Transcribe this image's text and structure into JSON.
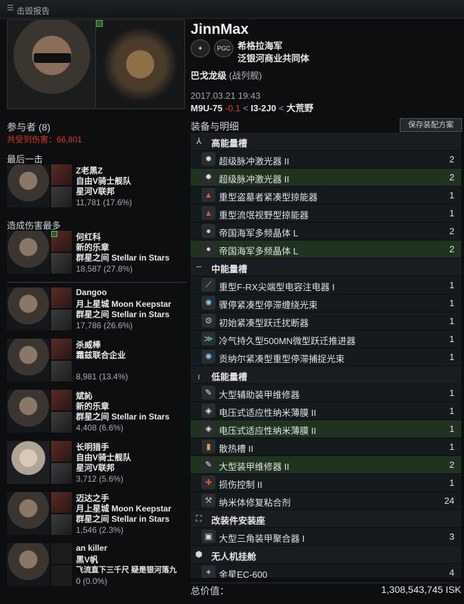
{
  "window": {
    "title": "击毁报告",
    "menu_icon": "menu-icon"
  },
  "victim": {
    "name": "JinnMax",
    "corporation": "希格拉海军",
    "alliance": "泛银河商业共同体",
    "alliance_logo_text": "PGC",
    "ship": "巴戈龙级",
    "ship_class": "(战列舰)",
    "datetime": "2017.03.21 19:43",
    "system": "M9U-75",
    "security": "-0.1",
    "sep1": "<",
    "region_part": "I3-2J0",
    "sep2": "<",
    "region": "大荒野"
  },
  "participants": {
    "header": "参与者 (8)",
    "damage_taken": "共受到伤害：66,801",
    "final_blow_header": "最后一击",
    "top_damage_header": "造成伤害最多",
    "final_blow": {
      "name": "Z老黑Z",
      "corp": "自由V骑士舰队",
      "alliance": "星河V联邦",
      "damage": "11,781 (17.6%)"
    },
    "attackers": [
      {
        "name": "何红科",
        "corp": "新的乐章",
        "alliance": "群星之间 Stellar in Stars",
        "damage": "18,587 (27.8%)"
      },
      {
        "name": "Dangoo",
        "corp": "月上星城 Moon Keepstar",
        "alliance": "群星之间 Stellar in Stars",
        "damage": "17,786 (26.6%)"
      },
      {
        "name": "杀威棒",
        "corp": "霜兹联合企业",
        "alliance": "",
        "damage": "8,981 (13.4%)"
      },
      {
        "name": "斌訫",
        "corp": "新的乐章",
        "alliance": "群星之间 Stellar in Stars",
        "damage": "4,408 (6.6%)"
      },
      {
        "name": "长明猎手",
        "corp": "自由V骑士舰队",
        "alliance": "星河V联邦",
        "damage": "3,712 (5.6%)"
      },
      {
        "name": "迈达之手",
        "corp": "月上星城 Moon Keepstar",
        "alliance": "群星之间 Stellar in Stars",
        "damage": "1,546 (2.3%)"
      },
      {
        "name": "an killer",
        "corp": "黑V帆",
        "alliance": "飞流直下三千尺 疑是银河落九",
        "damage": "0 (0.0%)"
      }
    ]
  },
  "fitting": {
    "header": "装备与明细",
    "save_button": "保存装配方案",
    "sections": [
      {
        "name": "高能量槽",
        "icon": "high-slot-icon",
        "items": [
          {
            "name": "超级脉冲激光器 II",
            "qty": "2",
            "dropped": false
          },
          {
            "name": "超级脉冲激光器 II",
            "qty": "2",
            "dropped": true
          },
          {
            "name": "重型盗墓者紧凑型掠能器",
            "qty": "1",
            "dropped": false
          },
          {
            "name": "重型流氓视野型掠能器",
            "qty": "1",
            "dropped": false
          },
          {
            "name": "帝国海军多频晶体 L",
            "qty": "2",
            "dropped": false
          },
          {
            "name": "帝国海军多频晶体 L",
            "qty": "2",
            "dropped": true
          }
        ]
      },
      {
        "name": "中能量槽",
        "icon": "mid-slot-icon",
        "items": [
          {
            "name": "重型F-RX尖端型电容注电器 I",
            "qty": "1",
            "dropped": false
          },
          {
            "name": "骤停紧凑型停滞缠绕光束",
            "qty": "1",
            "dropped": false
          },
          {
            "name": "初始紧凑型跃迁扰断器",
            "qty": "1",
            "dropped": false
          },
          {
            "name": "冷气持久型500MN微型跃迁推进器",
            "qty": "1",
            "dropped": false
          },
          {
            "name": "贡纳尔紧凑型重型停滞捕捉光束",
            "qty": "1",
            "dropped": false
          }
        ]
      },
      {
        "name": "低能量槽",
        "icon": "low-slot-icon",
        "items": [
          {
            "name": "大型辅助装甲维修器",
            "qty": "1",
            "dropped": false
          },
          {
            "name": "电压式适应性纳米薄膜 II",
            "qty": "1",
            "dropped": false
          },
          {
            "name": "电压式适应性纳米薄膜 II",
            "qty": "1",
            "dropped": true
          },
          {
            "name": "散热槽 II",
            "qty": "1",
            "dropped": false
          },
          {
            "name": "大型装甲维修器 II",
            "qty": "2",
            "dropped": true
          },
          {
            "name": "损伤控制 II",
            "qty": "1",
            "dropped": false
          },
          {
            "name": "纳米体修复粘合剂",
            "qty": "24",
            "dropped": false
          }
        ]
      },
      {
        "name": "改装件安装座",
        "icon": "rig-slot-icon",
        "items": [
          {
            "name": "大型三角装甲聚合器 I",
            "qty": "3",
            "dropped": false
          }
        ]
      },
      {
        "name": "无人机挂舱",
        "icon": "drone-bay-icon",
        "items": [
          {
            "name": "金星EC-600",
            "qty": "4",
            "dropped": false
          }
        ]
      }
    ],
    "total_label": "总价值：",
    "total_value": "1,308,543,745 ISK"
  }
}
